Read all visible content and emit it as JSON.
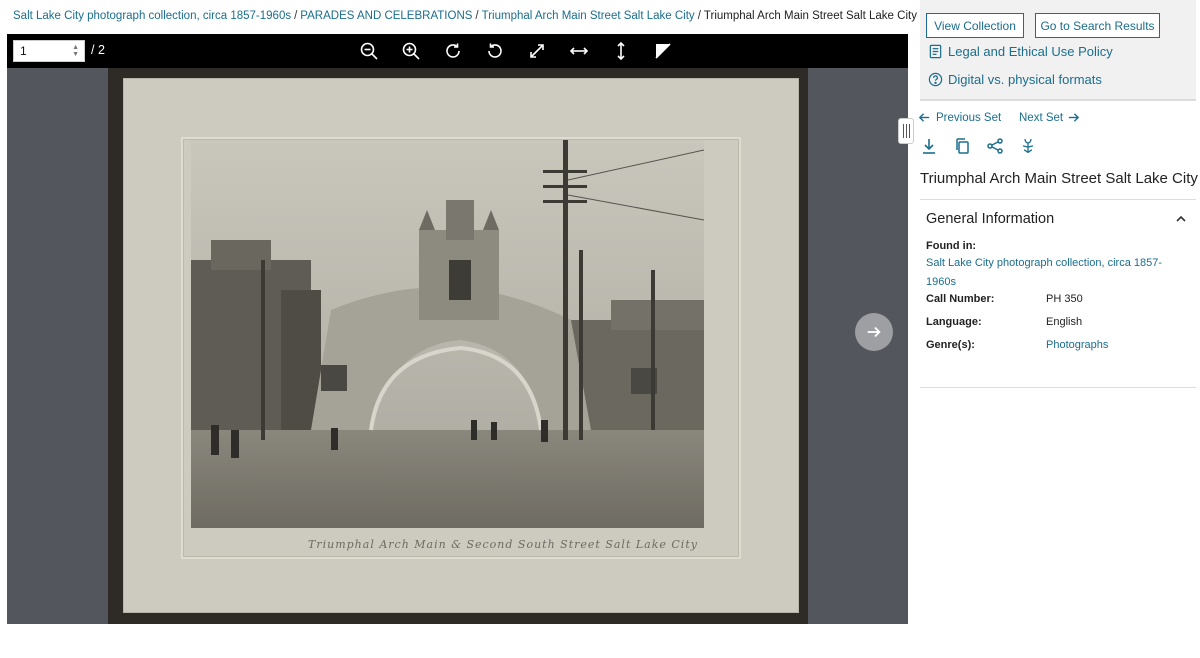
{
  "breadcrumb": {
    "items": [
      {
        "label": "Salt Lake City photograph collection, circa 1857-1960s",
        "link": true
      },
      {
        "label": "PARADES AND CELEBRATIONS",
        "link": true
      },
      {
        "label": "Triumphal Arch Main Street Salt Lake City",
        "link": true
      },
      {
        "label": "Triumphal Arch Main Street Salt Lake City",
        "link": false
      }
    ],
    "separator": "/"
  },
  "viewer": {
    "page_value": "1",
    "page_total": "/ 2",
    "tools": [
      "zoom-out-icon",
      "zoom-in-icon",
      "rotate-right-icon",
      "rotate-left-icon",
      "fullscreen-icon",
      "fit-width-icon",
      "fit-height-icon",
      "toggle-adjust-icon"
    ],
    "caption": "Triumphal Arch Main & Second South Street Salt Lake City"
  },
  "panel": {
    "view_collection": "View Collection",
    "search_results": "Go to Search Results",
    "legal_policy": "Legal and Ethical Use Policy",
    "formats": "Digital vs. physical formats",
    "previous_set": "Previous Set",
    "next_set": "Next Set",
    "actions": [
      "download-icon",
      "copy-icon",
      "share-icon",
      "iiif-icon"
    ],
    "title": "Triumphal Arch Main Street Salt Lake City",
    "section": "General Information",
    "found_in_label": "Found in:",
    "found_in_value": "Salt Lake City photograph collection, circa 1857-1960s",
    "call_number_label": "Call Number:",
    "call_number_value": "PH 350",
    "language_label": "Language:",
    "language_value": "English",
    "genre_label": "Genre(s):",
    "genre_value": "Photographs"
  },
  "colors": {
    "link": "#1a6e8e",
    "toolbar": "#000000",
    "canvas": "#53565c",
    "panel_bg": "#f1f1f1"
  }
}
